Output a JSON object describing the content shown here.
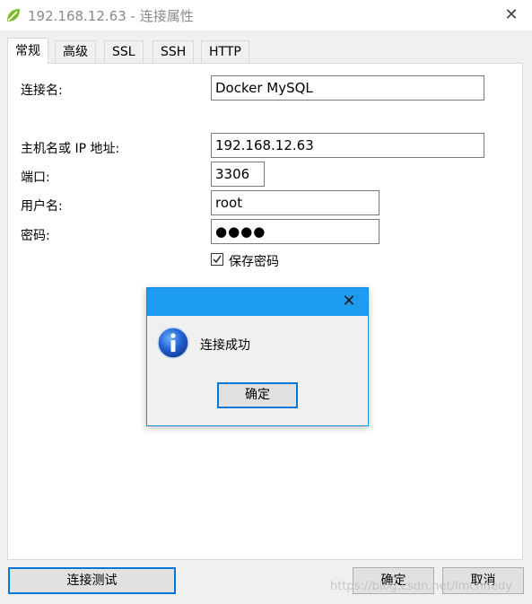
{
  "window": {
    "title": "192.168.12.63 - 连接属性",
    "close_glyph": "✕",
    "icon": "navicat-leaf-icon"
  },
  "tabs": [
    {
      "label": "常规",
      "active": true
    },
    {
      "label": "高级"
    },
    {
      "label": "SSL"
    },
    {
      "label": "SSH"
    },
    {
      "label": "HTTP"
    }
  ],
  "form": {
    "connection_name_label": "连接名:",
    "connection_name_value": "Docker MySQL",
    "host_label": "主机名或 IP 地址:",
    "host_value": "192.168.12.63",
    "port_label": "端口:",
    "port_value": "3306",
    "username_label": "用户名:",
    "username_value": "root",
    "password_label": "密码:",
    "password_value": "●●●●",
    "save_password_label": "保存密码",
    "save_password_checked": true
  },
  "buttons": {
    "test_connection": "连接测试",
    "ok": "确定",
    "cancel": "取消"
  },
  "dialog": {
    "close_glyph": "✕",
    "message": "连接成功",
    "ok": "确定",
    "icon": "info-icon"
  },
  "watermark": "https://blog.csdn.net/lmchhedy",
  "colors": {
    "dialog_title": "#1c9bf0",
    "focus_border": "#0078d7",
    "app_icon": "#7dbb2b"
  }
}
